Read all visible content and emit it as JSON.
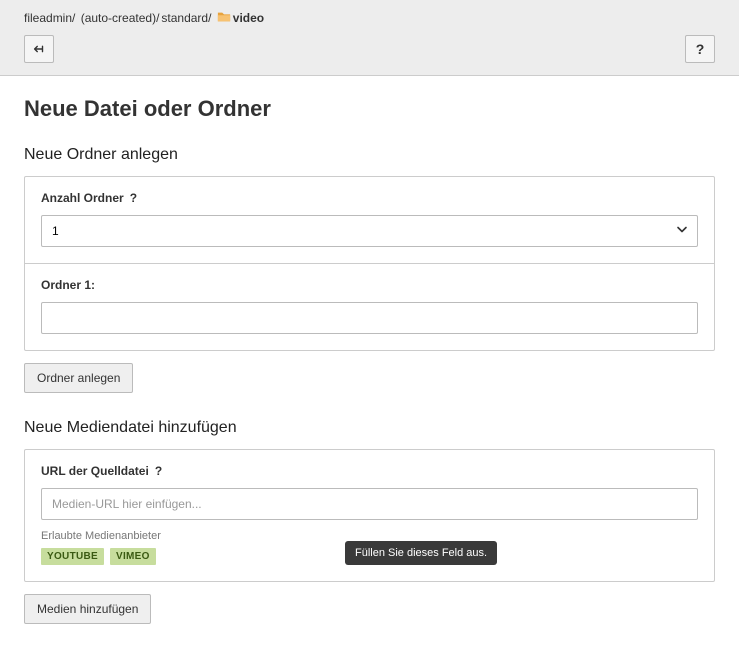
{
  "breadcrumb": {
    "seg1": "fileadmin/ ",
    "seg2": "(auto-created)/",
    "seg3": "standard/ ",
    "current": "video"
  },
  "topbar": {
    "help_label": "?"
  },
  "page": {
    "title": "Neue Datei oder Ordner"
  },
  "folders": {
    "section_title": "Neue Ordner anlegen",
    "count_label": "Anzahl Ordner",
    "count_help": "?",
    "count_value": "1",
    "name_label": "Ordner 1:",
    "name_value": "",
    "submit": "Ordner anlegen"
  },
  "media": {
    "section_title": "Neue Mediendatei hinzufügen",
    "url_label": "URL der Quelldatei",
    "url_help": "?",
    "url_placeholder": "Medien-URL hier einfügen...",
    "url_value": "",
    "providers_hint": "Erlaubte Medienanbieter",
    "providers": [
      "YOUTUBE",
      "VIMEO"
    ],
    "submit": "Medien hinzufügen",
    "tooltip": "Füllen Sie dieses Feld aus."
  }
}
